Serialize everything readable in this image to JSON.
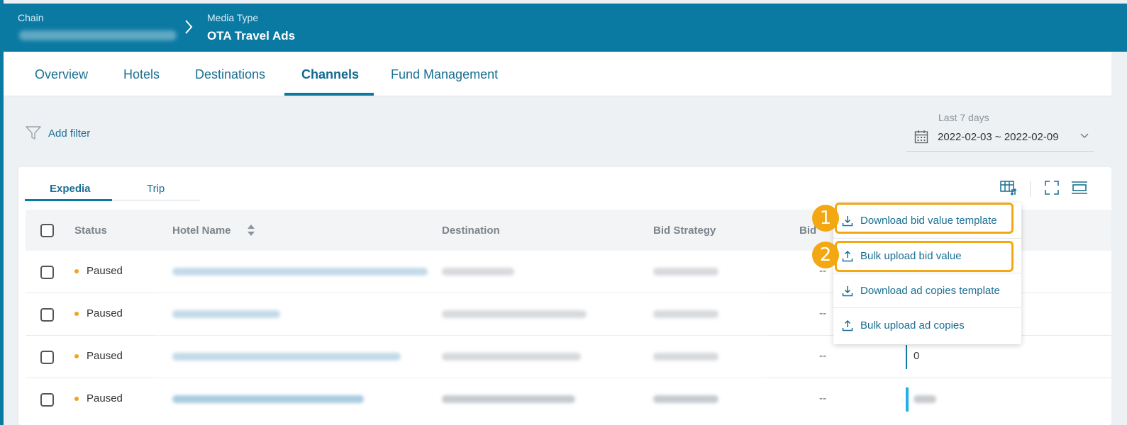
{
  "header": {
    "chain_label": "Chain",
    "media_type_label": "Media Type",
    "media_type_value": "OTA Travel Ads"
  },
  "nav_tabs": [
    {
      "label": "Overview",
      "active": false
    },
    {
      "label": "Hotels",
      "active": false
    },
    {
      "label": "Destinations",
      "active": false
    },
    {
      "label": "Channels",
      "active": true
    },
    {
      "label": "Fund Management",
      "active": false
    }
  ],
  "filter": {
    "label": "Add filter"
  },
  "date_range": {
    "caption": "Last 7 days",
    "value": "2022-02-03 ~ 2022-02-09"
  },
  "sub_tabs": [
    {
      "label": "Expedia",
      "active": true
    },
    {
      "label": "Trip",
      "active": false
    }
  ],
  "table": {
    "columns": [
      "Status",
      "Hotel Name",
      "Destination",
      "Bid Strategy",
      "Bid"
    ],
    "rows": [
      {
        "status": "Paused",
        "bid": "--",
        "bid_value": ""
      },
      {
        "status": "Paused",
        "bid": "--",
        "bid_value": ""
      },
      {
        "status": "Paused",
        "bid": "--",
        "bid_value": "0"
      },
      {
        "status": "Paused",
        "bid": "--",
        "bid_value": ""
      }
    ]
  },
  "menu": {
    "items": [
      {
        "label": "Download bid value template",
        "icon": "download-icon"
      },
      {
        "label": "Bulk upload bid value",
        "icon": "upload-icon"
      },
      {
        "label": "Download ad copies template",
        "icon": "download-icon"
      },
      {
        "label": "Bulk upload ad copies",
        "icon": "upload-icon"
      }
    ]
  },
  "annotations": {
    "step1": "1",
    "step2": "2"
  },
  "colors": {
    "brand": "#0b7aa3",
    "highlight": "#f3a712",
    "status_paused": "#f5a11a"
  }
}
